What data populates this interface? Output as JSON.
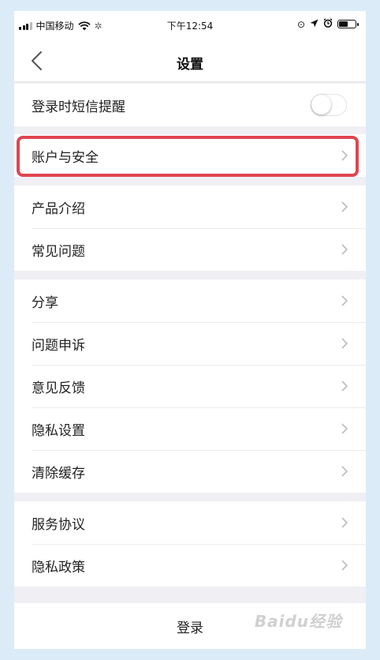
{
  "status_bar": {
    "carrier": "中国移动",
    "time": "下午12:54"
  },
  "nav": {
    "title": "设置"
  },
  "groups": [
    {
      "items": [
        {
          "label": "登录时短信提醒",
          "control": "toggle",
          "toggle_on": false
        }
      ]
    },
    {
      "items": [
        {
          "label": "账户与安全",
          "control": "chevron",
          "highlighted": true
        }
      ]
    },
    {
      "items": [
        {
          "label": "产品介绍",
          "control": "chevron"
        },
        {
          "label": "常见问题",
          "control": "chevron"
        }
      ]
    },
    {
      "items": [
        {
          "label": "分享",
          "control": "chevron"
        },
        {
          "label": "问题申诉",
          "control": "chevron"
        },
        {
          "label": "意见反馈",
          "control": "chevron"
        },
        {
          "label": "隐私设置",
          "control": "chevron"
        },
        {
          "label": "清除缓存",
          "control": "chevron"
        }
      ]
    },
    {
      "items": [
        {
          "label": "服务协议",
          "control": "chevron"
        },
        {
          "label": "隐私政策",
          "control": "chevron"
        }
      ]
    }
  ],
  "login_button": "登录",
  "watermark": "Baidu经验",
  "colors": {
    "highlight_border": "#e0454f",
    "page_background": "#efeff4",
    "outer_background": "#dcebf8"
  }
}
